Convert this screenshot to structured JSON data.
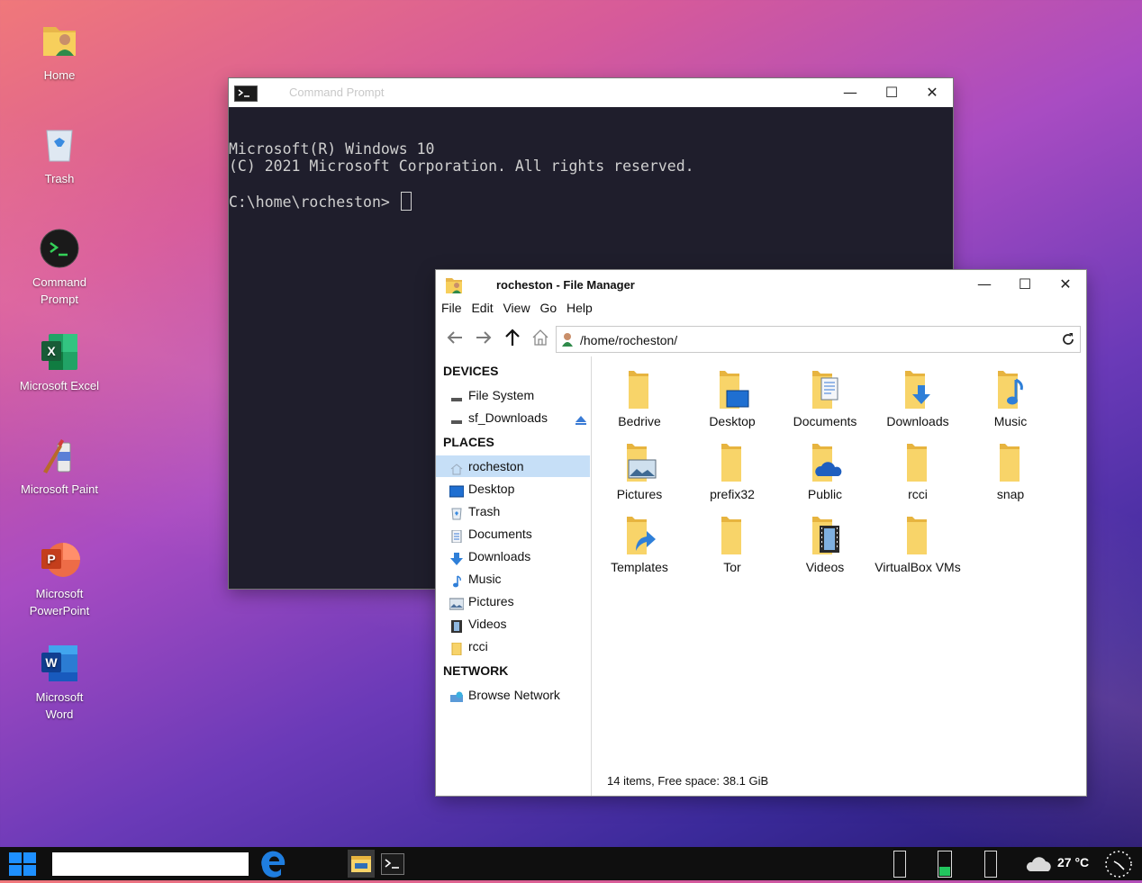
{
  "desktop": {
    "icons": [
      {
        "label": "Home",
        "icon": "home-folder-icon"
      },
      {
        "label": "Trash",
        "icon": "recycle-bin-icon"
      },
      {
        "label": "Command Prompt",
        "icon": "terminal-icon"
      },
      {
        "label": "Microsoft Excel",
        "icon": "excel-icon"
      },
      {
        "label": "Microsoft Paint",
        "icon": "paint-icon"
      },
      {
        "label": "Microsoft PowerPoint",
        "icon": "powerpoint-icon"
      },
      {
        "label": "Microsoft Word",
        "icon": "word-icon"
      }
    ]
  },
  "cmd": {
    "title": "Command Prompt",
    "line1": "Microsoft(R) Windows 10",
    "line2": "(C) 2021 Microsoft Corporation. All rights reserved.",
    "prompt": "C:\\home\\rocheston> "
  },
  "window_controls": {
    "minimize": "—",
    "maximize": "☐",
    "close": "✕"
  },
  "fm": {
    "title": "rocheston - File Manager",
    "menu": [
      "File",
      "Edit",
      "View",
      "Go",
      "Help"
    ],
    "path": "/home/rocheston/",
    "sections": {
      "devices": "DEVICES",
      "places": "PLACES",
      "network": "NETWORK"
    },
    "devices": [
      "File System",
      "sf_Downloads"
    ],
    "places": [
      "rocheston",
      "Desktop",
      "Trash",
      "Documents",
      "Downloads",
      "Music",
      "Pictures",
      "Videos",
      "rcci"
    ],
    "network": [
      "Browse Network"
    ],
    "items": [
      "Bedrive",
      "Desktop",
      "Documents",
      "Downloads",
      "Music",
      "Pictures",
      "prefix32",
      "Public",
      "rcci",
      "snap",
      "Templates",
      "Tor",
      "Videos",
      "VirtualBox VMs"
    ],
    "status": "14 items, Free space: 38.1 GiB"
  },
  "taskbar": {
    "search_value": "",
    "weather": "27 °C"
  }
}
